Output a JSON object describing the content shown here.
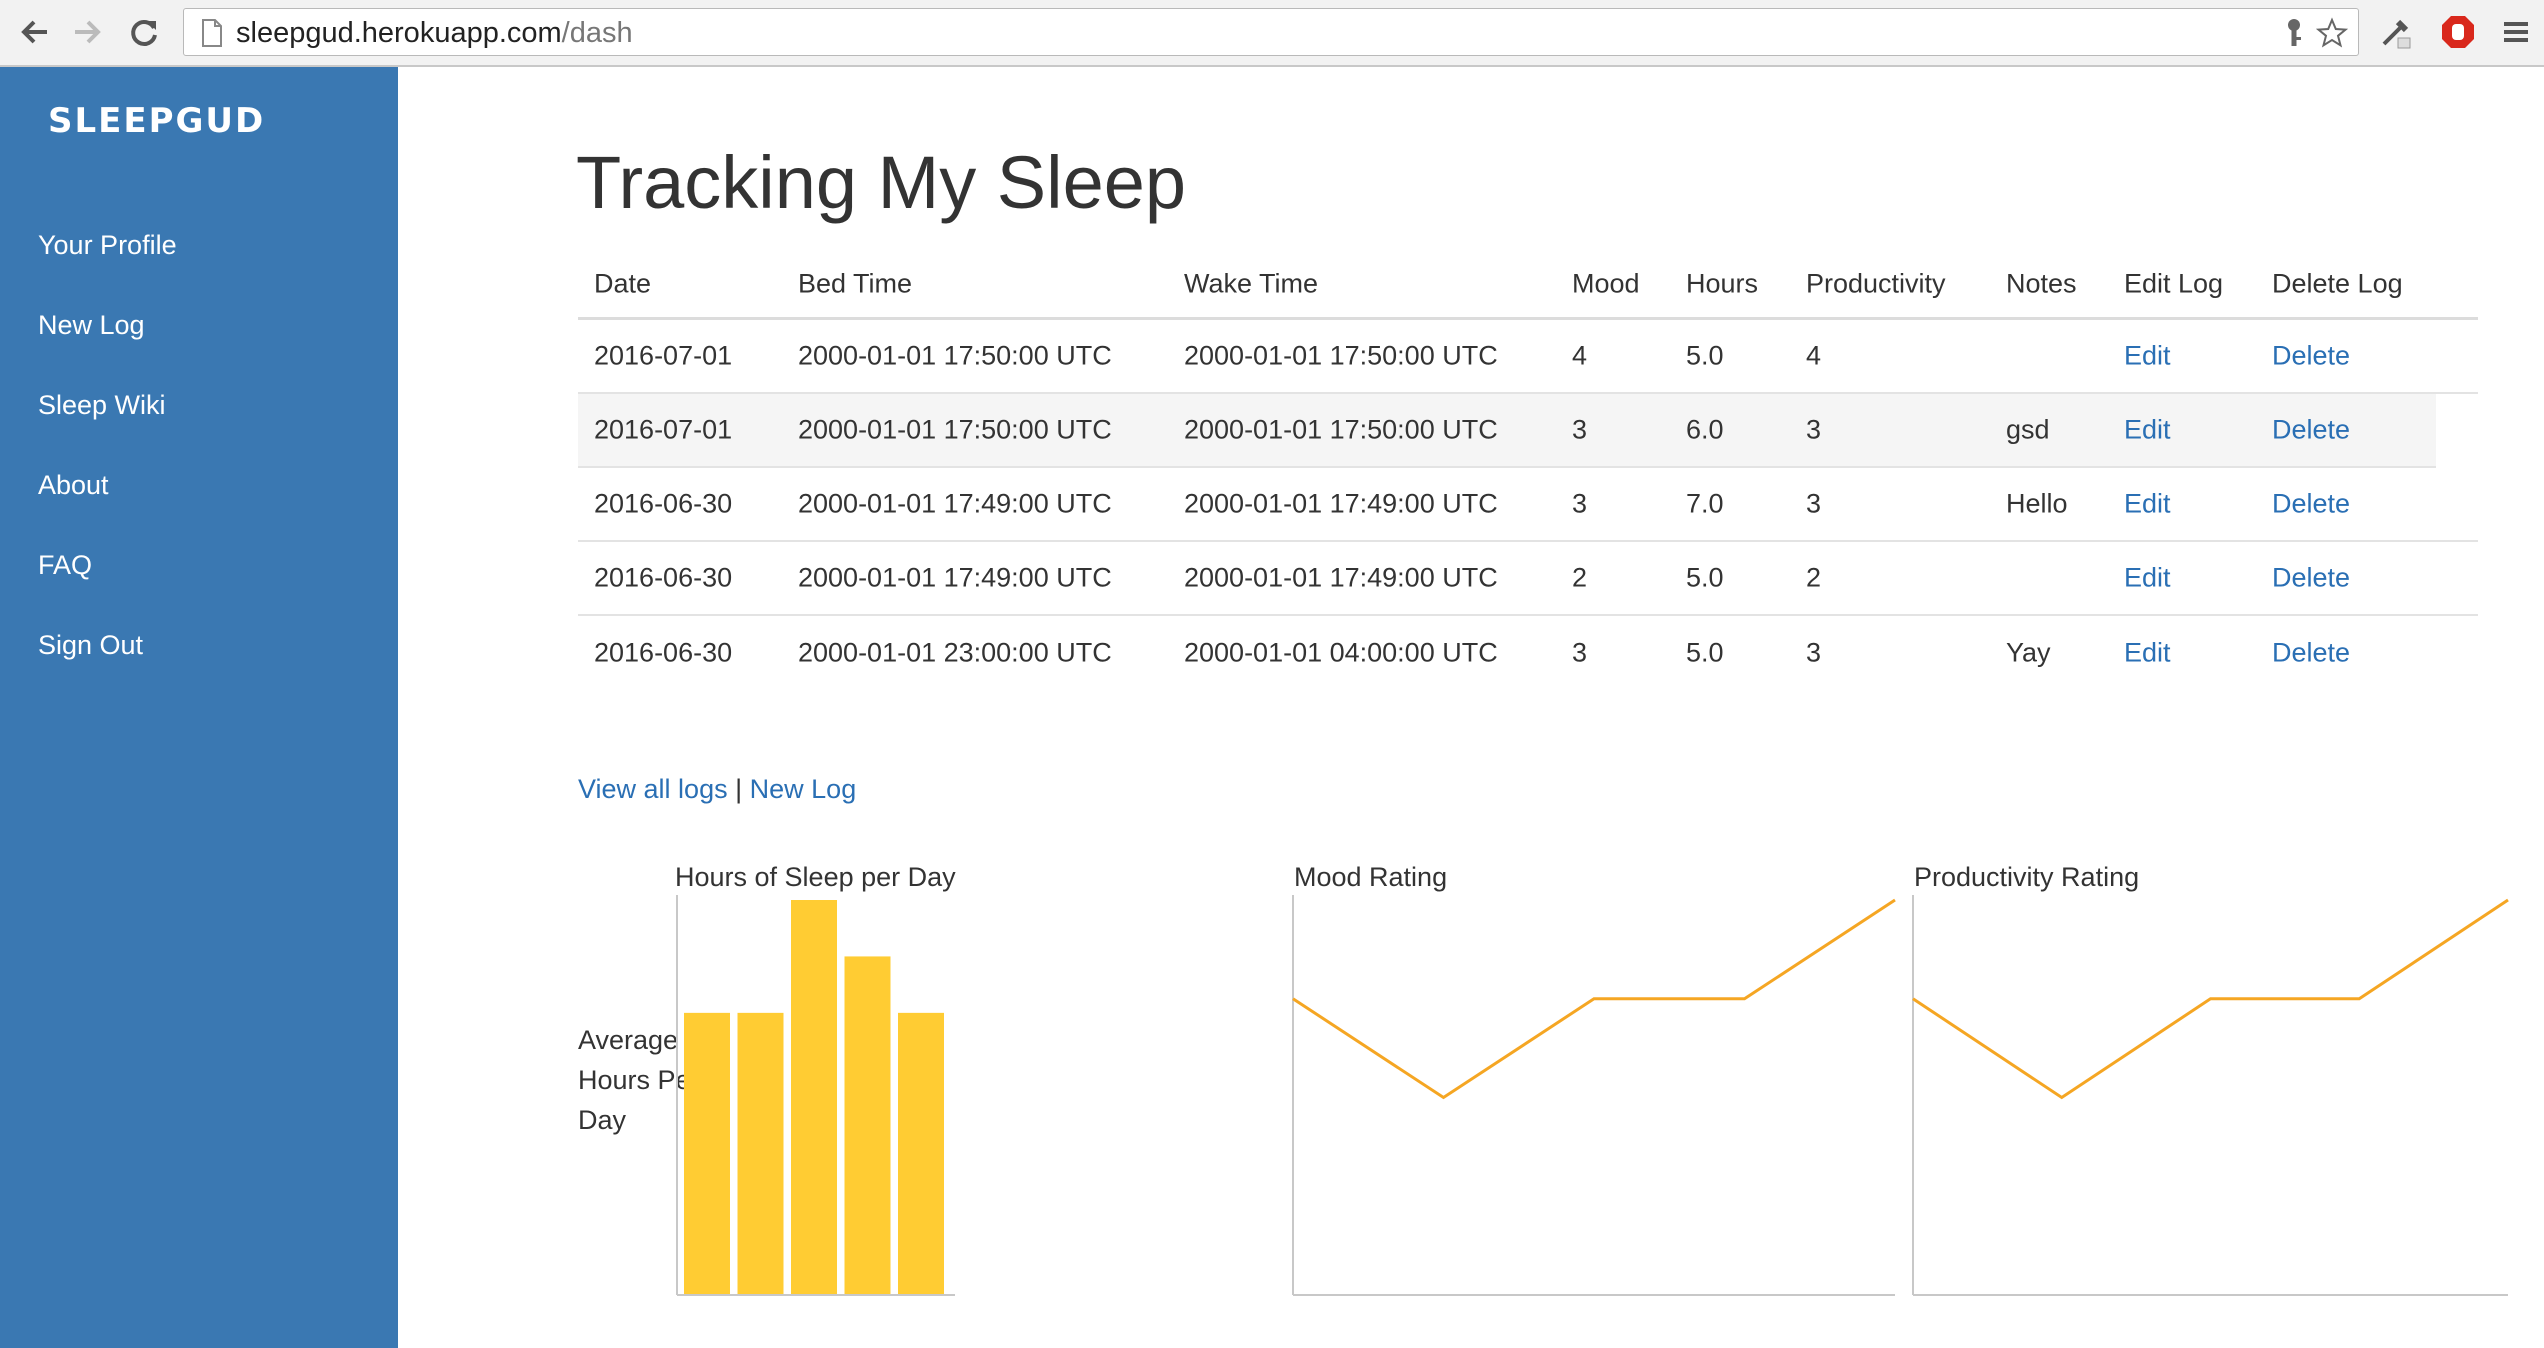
{
  "browser": {
    "url_host": "sleepgud.herokuapp.com",
    "url_path": "/dash"
  },
  "sidebar": {
    "brand": "SLEEPGUD",
    "items": [
      {
        "label": "Your Profile"
      },
      {
        "label": "New Log"
      },
      {
        "label": "Sleep Wiki"
      },
      {
        "label": "About"
      },
      {
        "label": "FAQ"
      },
      {
        "label": "Sign Out"
      }
    ]
  },
  "main": {
    "title": "Tracking My Sleep",
    "table": {
      "headers": [
        "Date",
        "Bed Time",
        "Wake Time",
        "Mood",
        "Hours",
        "Productivity",
        "Notes",
        "Edit Log",
        "Delete Log"
      ],
      "rows": [
        {
          "date": "2016-07-01",
          "bed": "2000-01-01 17:50:00 UTC",
          "wake": "2000-01-01 17:50:00 UTC",
          "mood": "4",
          "hours": "5.0",
          "productivity": "4",
          "notes": "",
          "edit": "Edit",
          "delete": "Delete"
        },
        {
          "date": "2016-07-01",
          "bed": "2000-01-01 17:50:00 UTC",
          "wake": "2000-01-01 17:50:00 UTC",
          "mood": "3",
          "hours": "6.0",
          "productivity": "3",
          "notes": "gsd",
          "edit": "Edit",
          "delete": "Delete"
        },
        {
          "date": "2016-06-30",
          "bed": "2000-01-01 17:49:00 UTC",
          "wake": "2000-01-01 17:49:00 UTC",
          "mood": "3",
          "hours": "7.0",
          "productivity": "3",
          "notes": "Hello",
          "edit": "Edit",
          "delete": "Delete"
        },
        {
          "date": "2016-06-30",
          "bed": "2000-01-01 17:49:00 UTC",
          "wake": "2000-01-01 17:49:00 UTC",
          "mood": "2",
          "hours": "5.0",
          "productivity": "2",
          "notes": "",
          "edit": "Edit",
          "delete": "Delete"
        },
        {
          "date": "2016-06-30",
          "bed": "2000-01-01 23:00:00 UTC",
          "wake": "2000-01-01 04:00:00 UTC",
          "mood": "3",
          "hours": "5.0",
          "productivity": "3",
          "notes": "Yay",
          "edit": "Edit",
          "delete": "Delete"
        }
      ]
    },
    "links": {
      "view_all": "View all logs",
      "separator": "|",
      "new_log": "New Log"
    }
  },
  "colors": {
    "sidebar": "#3a78b2",
    "link": "#2a6fb4",
    "bar": "#ffcc33",
    "line": "#f5a623"
  },
  "chart_data": [
    {
      "type": "bar",
      "title": "Hours of Sleep per Day",
      "ylabel": "Average Hours Per Day",
      "values": [
        5,
        5,
        7,
        6,
        5
      ],
      "ylim": [
        0,
        7
      ]
    },
    {
      "type": "line",
      "title": "Mood Rating",
      "values": [
        3,
        2,
        3,
        3,
        4
      ],
      "ylim": [
        0,
        4
      ]
    },
    {
      "type": "line",
      "title": "Productivity Rating",
      "values": [
        3,
        2,
        3,
        3,
        4
      ],
      "ylim": [
        0,
        4
      ]
    }
  ]
}
